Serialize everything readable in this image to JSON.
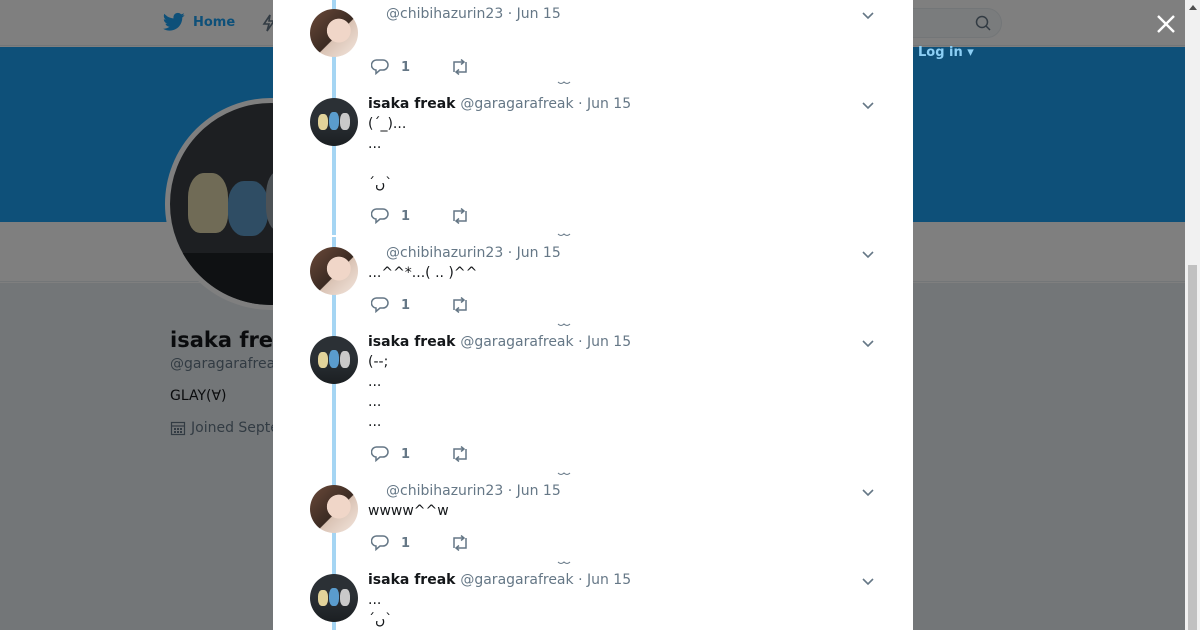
{
  "nav": {
    "home_label": "Home",
    "login_label": "Log in ▾"
  },
  "profile": {
    "name": "isaka fre",
    "handle": "@garagarafrea",
    "bio": "GLAY(∀)",
    "joined": "Joined Septe"
  },
  "tweets": [
    {
      "name": "",
      "handle": "@chibihazurin23",
      "date": "Jun 15",
      "text": "",
      "replies": "1",
      "avatar": "chibi"
    },
    {
      "name": "isaka freak",
      "handle": "@garagarafreak",
      "date": "Jun 15",
      "text": "(´_)...\n...\n\n´ںˋ",
      "replies": "1",
      "avatar": "isaka"
    },
    {
      "name": "",
      "handle": "@chibihazurin23",
      "date": "Jun 15",
      "text": "...^^*...( .. )^^",
      "replies": "1",
      "avatar": "chibi"
    },
    {
      "name": "isaka freak",
      "handle": "@garagarafreak",
      "date": "Jun 15",
      "text": "(--;\n...\n...\n...",
      "replies": "1",
      "avatar": "isaka"
    },
    {
      "name": "",
      "handle": "@chibihazurin23",
      "date": "Jun 15",
      "text": "wwww^^w",
      "replies": "1",
      "avatar": "chibi"
    },
    {
      "name": "isaka freak",
      "handle": "@garagarafreak",
      "date": "Jun 15",
      "text": "...\n´ںˋ",
      "replies": "",
      "avatar": "isaka"
    }
  ],
  "separator": "·",
  "colors": {
    "accent": "#1da1f2",
    "thread_line": "#a5d5f3",
    "muted": "#657786"
  }
}
